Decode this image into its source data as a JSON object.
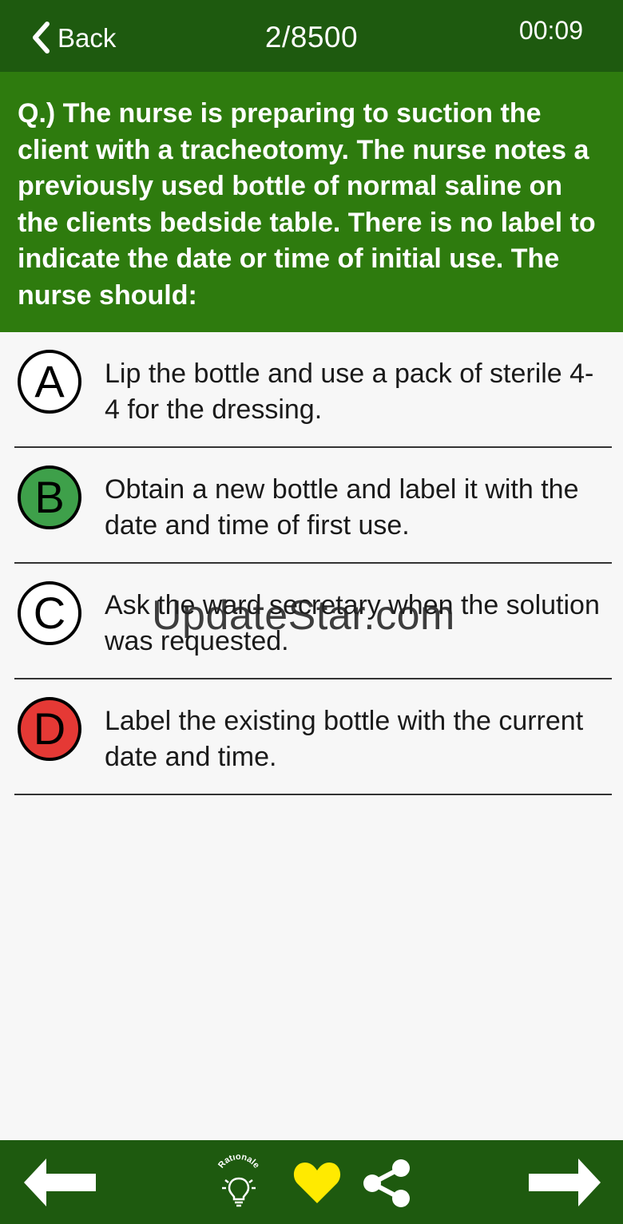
{
  "header": {
    "back_label": "Back",
    "counter": "2/8500",
    "timer": "00:09"
  },
  "question": {
    "text": "Q.) The nurse is preparing to suction the client with a tracheotomy. The nurse notes a previously used bottle of normal saline on the clients bedside table. There is no label to indicate the date or time of initial use. The nurse should:"
  },
  "options": [
    {
      "letter": "A",
      "text": "Lip the bottle and use a pack of sterile 4-4 for the dressing.",
      "badge_color": "#ffffff"
    },
    {
      "letter": "B",
      "text": "Obtain a new bottle and label it with the date and time of first use.",
      "badge_color": "#3ea04a"
    },
    {
      "letter": "C",
      "text": "Ask the ward secretary when the solution was requested.",
      "badge_color": "#ffffff"
    },
    {
      "letter": "D",
      "text": "Label the existing bottle with the current date and time.",
      "badge_color": "#e53935"
    }
  ],
  "watermark": "UpdateStar.com",
  "footer": {
    "rationale_label": "Rationale",
    "icons": [
      "previous-arrow-icon",
      "rationale-lightbulb-icon",
      "favorite-heart-icon",
      "share-icon",
      "next-arrow-icon"
    ],
    "heart_color": "#ffea00"
  },
  "colors": {
    "header_bg": "#1e5a0f",
    "question_bg": "#2e7b0e",
    "page_bg": "#f7f7f7"
  }
}
